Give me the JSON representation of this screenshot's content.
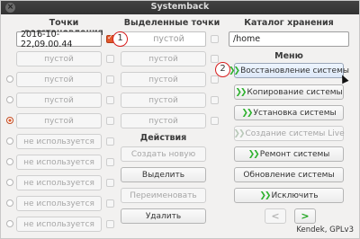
{
  "window": {
    "title": "Systemback",
    "close_glyph": "×"
  },
  "headers": {
    "restore_points": "Точки восстановления",
    "selected_points": "Выделенные точки",
    "storage_dir": "Каталог хранения",
    "menu": "Меню",
    "actions": "Действия"
  },
  "restore_points": [
    {
      "value": "2016-10-22,09.00.44",
      "editable": true,
      "checked": true
    },
    {
      "value": "пустой"
    },
    {
      "value": "пустой"
    },
    {
      "value": "пустой"
    },
    {
      "value": "пустой"
    },
    {
      "value": "не используется"
    },
    {
      "value": "не используется"
    },
    {
      "value": "не используется"
    },
    {
      "value": "не используется"
    },
    {
      "value": "не используется"
    }
  ],
  "selected_points": [
    "пустой",
    "пустой",
    "пустой",
    "пустой",
    "пустой"
  ],
  "storage_path": "/home",
  "actions": {
    "create_new": "Создать новую",
    "select": "Выделить",
    "rename": "Переименовать",
    "delete": "Удалить"
  },
  "menu_items": {
    "restore": "Восстановление системы",
    "copy": "Копирование системы",
    "install": "Установка системы",
    "live": "Создание системы Live",
    "repair": "Ремонт системы",
    "update": "Обновление системы",
    "exclude": "Исключить"
  },
  "annotations": {
    "marker1": "1",
    "marker2": "2"
  },
  "nav": {
    "back": "<",
    "forward": ">"
  },
  "footer": "Kendek, GPLv3",
  "colors": {
    "accent_orange": "#e2582c",
    "chevron_green": "#2fb12f",
    "annotation_red": "#d81e1e"
  }
}
